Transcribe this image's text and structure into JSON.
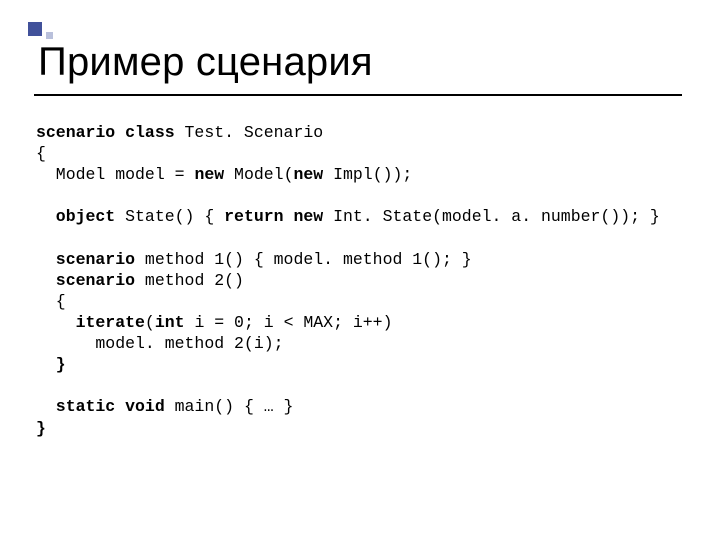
{
  "title": "Пример сценария",
  "code": {
    "l1a": "scenario class",
    "l1b": " Test. Scenario",
    "l2": "{",
    "l3a": "  Model model = ",
    "l3b": "new",
    "l3c": " Model(",
    "l3d": "new",
    "l3e": " Impl());",
    "l4": "",
    "l5a": "  object",
    "l5b": " State() { ",
    "l5c": "return new",
    "l5d": " Int. State(model. a. number()); }",
    "l6": "",
    "l7a": "  scenario",
    "l7b": " method 1() { model. method 1(); }",
    "l8a": "  scenario",
    "l8b": " method 2()",
    "l9": "  {",
    "l10a": "    iterate",
    "l10b": "(",
    "l10c": "int",
    "l10d": " i = 0; i < MAX; i++)",
    "l11": "      model. method 2(i);",
    "l12a": "  }",
    "l13": "",
    "l14a": "  static void",
    "l14b": " main() { … }",
    "l15": "}"
  }
}
